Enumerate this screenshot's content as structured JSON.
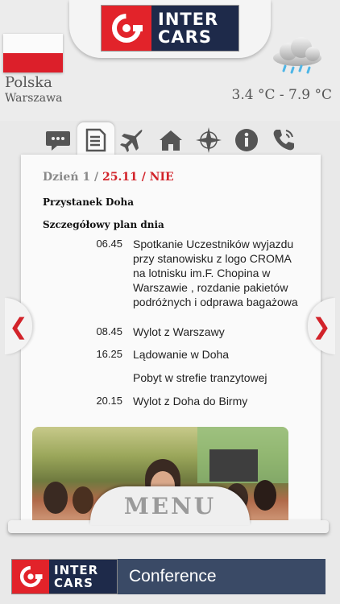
{
  "brand": {
    "logo_line1": "INTER",
    "logo_line2": "CARS",
    "primary_color": "#e2232a",
    "secondary_color": "#1e2a4a"
  },
  "location": {
    "country": "Polska",
    "city": "Warszawa",
    "flag": "poland-flag"
  },
  "weather": {
    "icon": "cloud-rain-icon",
    "temperature": "3.4 °C - 7.9 °C"
  },
  "tabs": [
    {
      "name": "chat",
      "icon": "speech-bubble-icon",
      "active": false
    },
    {
      "name": "schedule",
      "icon": "document-list-icon",
      "active": true
    },
    {
      "name": "flight",
      "icon": "airplane-icon",
      "active": false
    },
    {
      "name": "hotel",
      "icon": "house-icon",
      "active": false
    },
    {
      "name": "navigation",
      "icon": "compass-star-icon",
      "active": false
    },
    {
      "name": "info",
      "icon": "info-icon",
      "active": false
    },
    {
      "name": "phone",
      "icon": "phone-icon",
      "active": false
    }
  ],
  "schedule": {
    "day_label": "Dzień 1 /",
    "date_label": "25.11 / NIE",
    "stop_title": "Przystanek Doha",
    "plan_title": "Szczegółowy plan dnia",
    "items": [
      {
        "time": "06.45",
        "text": "Spotkanie Uczestników wyjazdu przy stanowisku z logo CROMA na lotnisku im.F. Chopina w Warszawie , rozdanie pakietów podróżnych i odprawa bagażowa"
      },
      {
        "time": "08.45",
        "text": "Wylot z Warszawy"
      },
      {
        "time": "16.25",
        "text": "Lądowanie w Doha"
      },
      {
        "time": "",
        "text": "Pobyt w strefie tranzytowej"
      },
      {
        "time": "20.15",
        "text": "Wylot z Doha do Birmy"
      }
    ]
  },
  "nav": {
    "prev": "❮",
    "next": "❯"
  },
  "menu": {
    "label": "MENU"
  },
  "footer": {
    "logo_line1": "INTER",
    "logo_line2": "CARS",
    "label": "Conference"
  }
}
